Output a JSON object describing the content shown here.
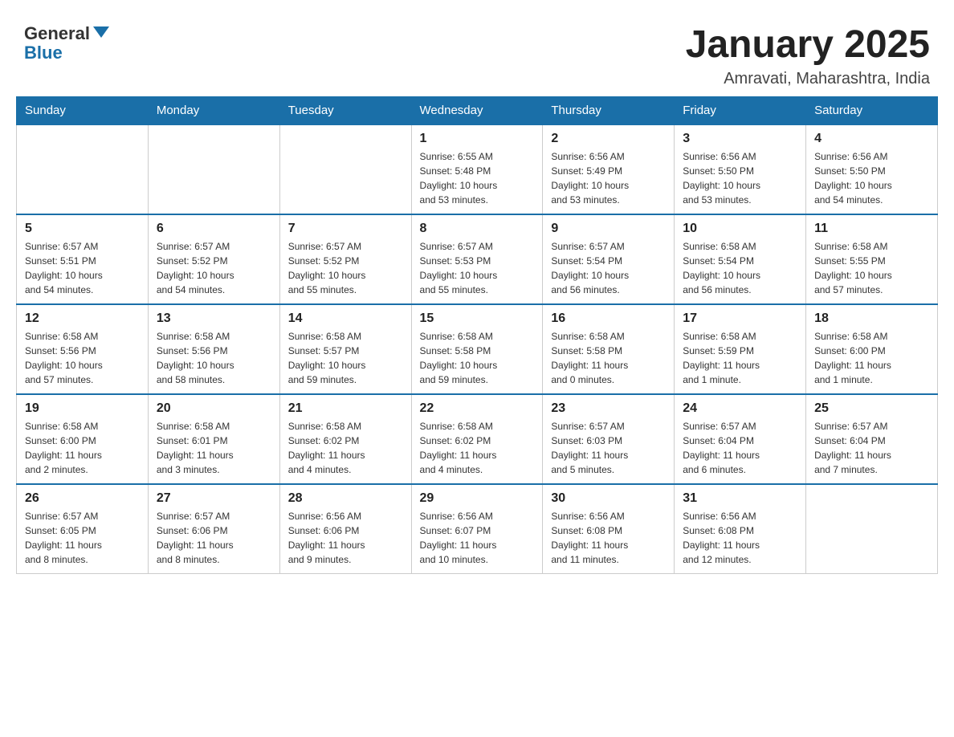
{
  "header": {
    "logo_general": "General",
    "logo_blue": "Blue",
    "month_title": "January 2025",
    "location": "Amravati, Maharashtra, India"
  },
  "weekdays": [
    "Sunday",
    "Monday",
    "Tuesday",
    "Wednesday",
    "Thursday",
    "Friday",
    "Saturday"
  ],
  "weeks": [
    [
      {
        "day": "",
        "info": ""
      },
      {
        "day": "",
        "info": ""
      },
      {
        "day": "",
        "info": ""
      },
      {
        "day": "1",
        "info": "Sunrise: 6:55 AM\nSunset: 5:48 PM\nDaylight: 10 hours\nand 53 minutes."
      },
      {
        "day": "2",
        "info": "Sunrise: 6:56 AM\nSunset: 5:49 PM\nDaylight: 10 hours\nand 53 minutes."
      },
      {
        "day": "3",
        "info": "Sunrise: 6:56 AM\nSunset: 5:50 PM\nDaylight: 10 hours\nand 53 minutes."
      },
      {
        "day": "4",
        "info": "Sunrise: 6:56 AM\nSunset: 5:50 PM\nDaylight: 10 hours\nand 54 minutes."
      }
    ],
    [
      {
        "day": "5",
        "info": "Sunrise: 6:57 AM\nSunset: 5:51 PM\nDaylight: 10 hours\nand 54 minutes."
      },
      {
        "day": "6",
        "info": "Sunrise: 6:57 AM\nSunset: 5:52 PM\nDaylight: 10 hours\nand 54 minutes."
      },
      {
        "day": "7",
        "info": "Sunrise: 6:57 AM\nSunset: 5:52 PM\nDaylight: 10 hours\nand 55 minutes."
      },
      {
        "day": "8",
        "info": "Sunrise: 6:57 AM\nSunset: 5:53 PM\nDaylight: 10 hours\nand 55 minutes."
      },
      {
        "day": "9",
        "info": "Sunrise: 6:57 AM\nSunset: 5:54 PM\nDaylight: 10 hours\nand 56 minutes."
      },
      {
        "day": "10",
        "info": "Sunrise: 6:58 AM\nSunset: 5:54 PM\nDaylight: 10 hours\nand 56 minutes."
      },
      {
        "day": "11",
        "info": "Sunrise: 6:58 AM\nSunset: 5:55 PM\nDaylight: 10 hours\nand 57 minutes."
      }
    ],
    [
      {
        "day": "12",
        "info": "Sunrise: 6:58 AM\nSunset: 5:56 PM\nDaylight: 10 hours\nand 57 minutes."
      },
      {
        "day": "13",
        "info": "Sunrise: 6:58 AM\nSunset: 5:56 PM\nDaylight: 10 hours\nand 58 minutes."
      },
      {
        "day": "14",
        "info": "Sunrise: 6:58 AM\nSunset: 5:57 PM\nDaylight: 10 hours\nand 59 minutes."
      },
      {
        "day": "15",
        "info": "Sunrise: 6:58 AM\nSunset: 5:58 PM\nDaylight: 10 hours\nand 59 minutes."
      },
      {
        "day": "16",
        "info": "Sunrise: 6:58 AM\nSunset: 5:58 PM\nDaylight: 11 hours\nand 0 minutes."
      },
      {
        "day": "17",
        "info": "Sunrise: 6:58 AM\nSunset: 5:59 PM\nDaylight: 11 hours\nand 1 minute."
      },
      {
        "day": "18",
        "info": "Sunrise: 6:58 AM\nSunset: 6:00 PM\nDaylight: 11 hours\nand 1 minute."
      }
    ],
    [
      {
        "day": "19",
        "info": "Sunrise: 6:58 AM\nSunset: 6:00 PM\nDaylight: 11 hours\nand 2 minutes."
      },
      {
        "day": "20",
        "info": "Sunrise: 6:58 AM\nSunset: 6:01 PM\nDaylight: 11 hours\nand 3 minutes."
      },
      {
        "day": "21",
        "info": "Sunrise: 6:58 AM\nSunset: 6:02 PM\nDaylight: 11 hours\nand 4 minutes."
      },
      {
        "day": "22",
        "info": "Sunrise: 6:58 AM\nSunset: 6:02 PM\nDaylight: 11 hours\nand 4 minutes."
      },
      {
        "day": "23",
        "info": "Sunrise: 6:57 AM\nSunset: 6:03 PM\nDaylight: 11 hours\nand 5 minutes."
      },
      {
        "day": "24",
        "info": "Sunrise: 6:57 AM\nSunset: 6:04 PM\nDaylight: 11 hours\nand 6 minutes."
      },
      {
        "day": "25",
        "info": "Sunrise: 6:57 AM\nSunset: 6:04 PM\nDaylight: 11 hours\nand 7 minutes."
      }
    ],
    [
      {
        "day": "26",
        "info": "Sunrise: 6:57 AM\nSunset: 6:05 PM\nDaylight: 11 hours\nand 8 minutes."
      },
      {
        "day": "27",
        "info": "Sunrise: 6:57 AM\nSunset: 6:06 PM\nDaylight: 11 hours\nand 8 minutes."
      },
      {
        "day": "28",
        "info": "Sunrise: 6:56 AM\nSunset: 6:06 PM\nDaylight: 11 hours\nand 9 minutes."
      },
      {
        "day": "29",
        "info": "Sunrise: 6:56 AM\nSunset: 6:07 PM\nDaylight: 11 hours\nand 10 minutes."
      },
      {
        "day": "30",
        "info": "Sunrise: 6:56 AM\nSunset: 6:08 PM\nDaylight: 11 hours\nand 11 minutes."
      },
      {
        "day": "31",
        "info": "Sunrise: 6:56 AM\nSunset: 6:08 PM\nDaylight: 11 hours\nand 12 minutes."
      },
      {
        "day": "",
        "info": ""
      }
    ]
  ]
}
